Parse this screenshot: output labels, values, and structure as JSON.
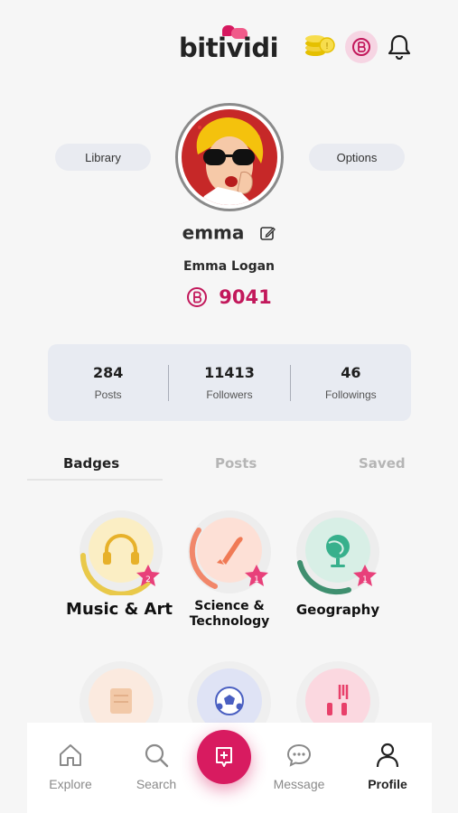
{
  "header": {
    "logo_text": "bitividi",
    "icons": {
      "coins": "coins-icon",
      "points": "b-points-icon",
      "notifications": "bell-icon"
    }
  },
  "profile": {
    "library_label": "Library",
    "options_label": "Options",
    "username": "emma",
    "full_name": "Emma Logan",
    "points": "9041"
  },
  "stats": [
    {
      "value": "284",
      "label": "Posts"
    },
    {
      "value": "11413",
      "label": "Followers"
    },
    {
      "value": "46",
      "label": "Followings"
    }
  ],
  "tabs": [
    {
      "label": "Badges",
      "active": true
    },
    {
      "label": "Posts",
      "active": false
    },
    {
      "label": "Saved",
      "active": false
    }
  ],
  "badges": [
    {
      "label": "Music & Art",
      "level": "2",
      "icon": "headphones-icon"
    },
    {
      "label": "Science & Technology",
      "level": "1",
      "icon": "rocket-icon"
    },
    {
      "label": "Geography",
      "level": "1",
      "icon": "globe-icon"
    },
    {
      "label": "",
      "level": "",
      "icon": "scroll-icon"
    },
    {
      "label": "",
      "level": "",
      "icon": "soccer-ball-icon"
    },
    {
      "label": "",
      "level": "",
      "icon": "fork-icon"
    }
  ],
  "nav": [
    {
      "label": "Explore",
      "icon": "home-icon"
    },
    {
      "label": "Search",
      "icon": "search-icon"
    },
    {
      "label": "",
      "icon": "create-post-icon"
    },
    {
      "label": "Message",
      "icon": "message-icon"
    },
    {
      "label": "Profile",
      "icon": "profile-icon",
      "active": true
    }
  ],
  "colors": {
    "accent": "#d81b60",
    "background": "#f6f6f6",
    "stats_bg": "#e8ebf2"
  }
}
